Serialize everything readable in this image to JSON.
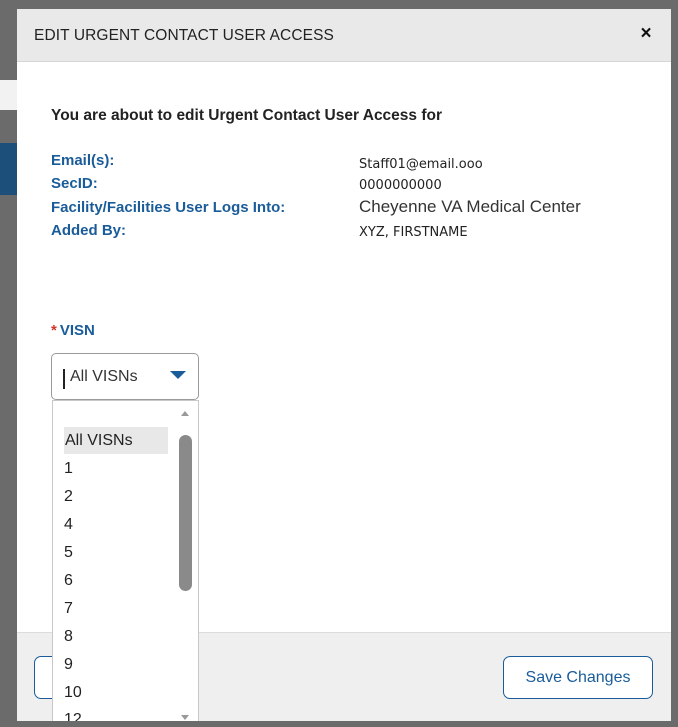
{
  "modal": {
    "title": "EDIT URGENT CONTACT USER ACCESS",
    "close_glyph": "×"
  },
  "intro": "You are about to edit Urgent Contact User Access for",
  "info": {
    "email_label": "Email(s):",
    "email_value": "Staff01@email.ooo",
    "secid_label": "SecID:",
    "secid_value": "0000000000",
    "facility_label": "Facility/Facilities User Logs Into:",
    "facility_value": "Cheyenne VA Medical Center",
    "added_by_label": "Added By:",
    "added_by_value": "XYZ, FIRSTNAME"
  },
  "visn": {
    "required_mark": "*",
    "label": "VISN",
    "selected": "All VISNs",
    "options": [
      "All VISNs",
      "1",
      "2",
      "4",
      "5",
      "6",
      "7",
      "8",
      "9",
      "10",
      "12"
    ]
  },
  "footer": {
    "save_label": "Save Changes"
  },
  "colors": {
    "accent": "#1a5c99",
    "required": "#d0342c",
    "header_bg": "#e9e9e9",
    "overlay": "#6b6b6b"
  }
}
